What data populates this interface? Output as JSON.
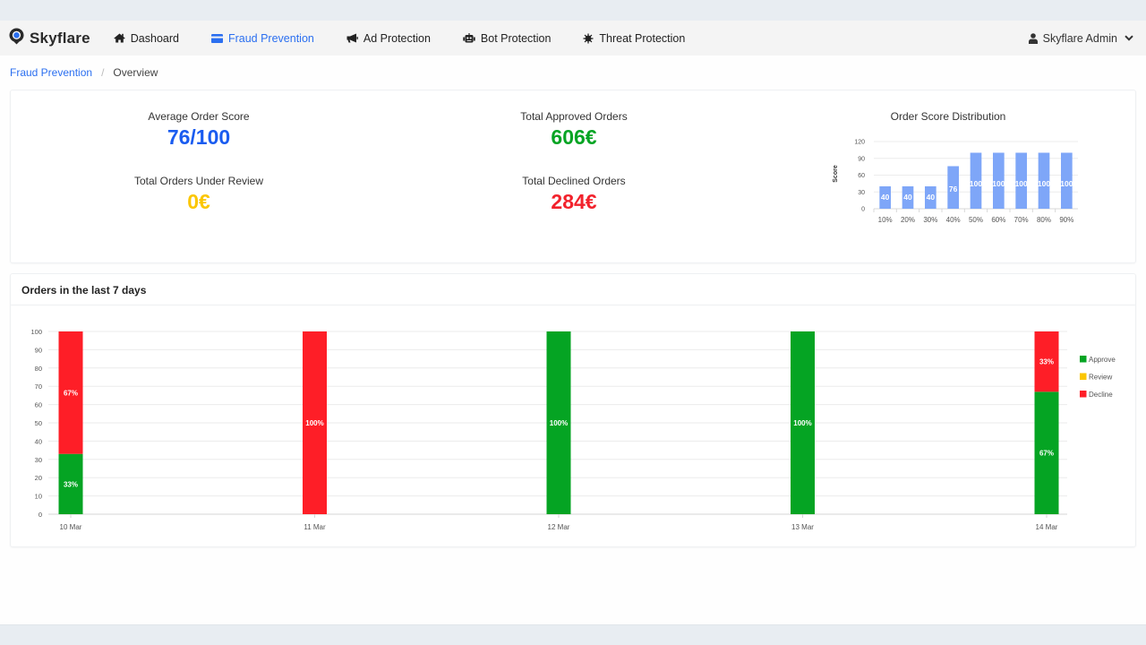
{
  "app": {
    "brand_name": "Skyflare"
  },
  "nav": {
    "items": [
      {
        "label": "Dashoard",
        "icon": "home-icon",
        "active": false
      },
      {
        "label": "Fraud Prevention",
        "icon": "credit-card-icon",
        "active": true
      },
      {
        "label": "Ad Protection",
        "icon": "megaphone-icon",
        "active": false
      },
      {
        "label": "Bot Protection",
        "icon": "robot-icon",
        "active": false
      },
      {
        "label": "Threat Protection",
        "icon": "virus-icon",
        "active": false
      }
    ],
    "user": {
      "label": "Skyflare Admin",
      "icon": "user-icon"
    }
  },
  "breadcrumb": {
    "parent": "Fraud Prevention",
    "separator": "/",
    "current": "Overview"
  },
  "stats": {
    "average_order_score": {
      "label": "Average Order Score",
      "value": "76/100",
      "color": "#1a5cf0"
    },
    "total_approved": {
      "label": "Total Approved Orders",
      "value": "606€",
      "color": "#05a423"
    },
    "total_review": {
      "label": "Total Orders Under Review",
      "value": "0€",
      "color": "#fbc600"
    },
    "total_declined": {
      "label": "Total Declined Orders",
      "value": "284€",
      "color": "#f2222c"
    }
  },
  "orders_panel": {
    "title": "Orders in the last 7 days"
  },
  "chart_data": [
    {
      "type": "bar",
      "title": "Order Score Distribution",
      "xlabel": "",
      "ylabel": "Score",
      "categories": [
        "10%",
        "20%",
        "30%",
        "40%",
        "50%",
        "60%",
        "70%",
        "80%",
        "90%"
      ],
      "values": [
        40,
        40,
        40,
        76,
        100,
        100,
        100,
        100,
        100
      ],
      "data_labels": [
        "40",
        "40",
        "40",
        "76",
        "100",
        "100",
        "100",
        "100",
        "100"
      ],
      "ylim": [
        0,
        120
      ],
      "yticks": [
        0,
        30,
        60,
        90,
        120
      ],
      "grid": true,
      "color": "#7ea6f8"
    },
    {
      "type": "bar",
      "stacked": true,
      "title": "Orders in the last 7 days",
      "xlabel": "",
      "ylabel": "",
      "categories": [
        "10 Mar",
        "11 Mar",
        "12 Mar",
        "13 Mar",
        "14 Mar"
      ],
      "series": [
        {
          "name": "Approve",
          "color": "#05a423",
          "values": [
            33,
            0,
            100,
            100,
            67
          ],
          "labels": [
            "33%",
            "",
            "100%",
            "100%",
            "67%"
          ]
        },
        {
          "name": "Review",
          "color": "#fbc600",
          "values": [
            0,
            0,
            0,
            0,
            0
          ],
          "labels": [
            "",
            "",
            "",
            "",
            ""
          ]
        },
        {
          "name": "Decline",
          "color": "#fe1e27",
          "values": [
            67,
            100,
            0,
            0,
            33
          ],
          "labels": [
            "67%",
            "100%",
            "",
            "",
            "33%"
          ]
        }
      ],
      "ylim": [
        0,
        100
      ],
      "yticks": [
        0,
        10,
        20,
        30,
        40,
        50,
        60,
        70,
        80,
        90,
        100
      ],
      "grid": true,
      "legend": "right"
    }
  ]
}
